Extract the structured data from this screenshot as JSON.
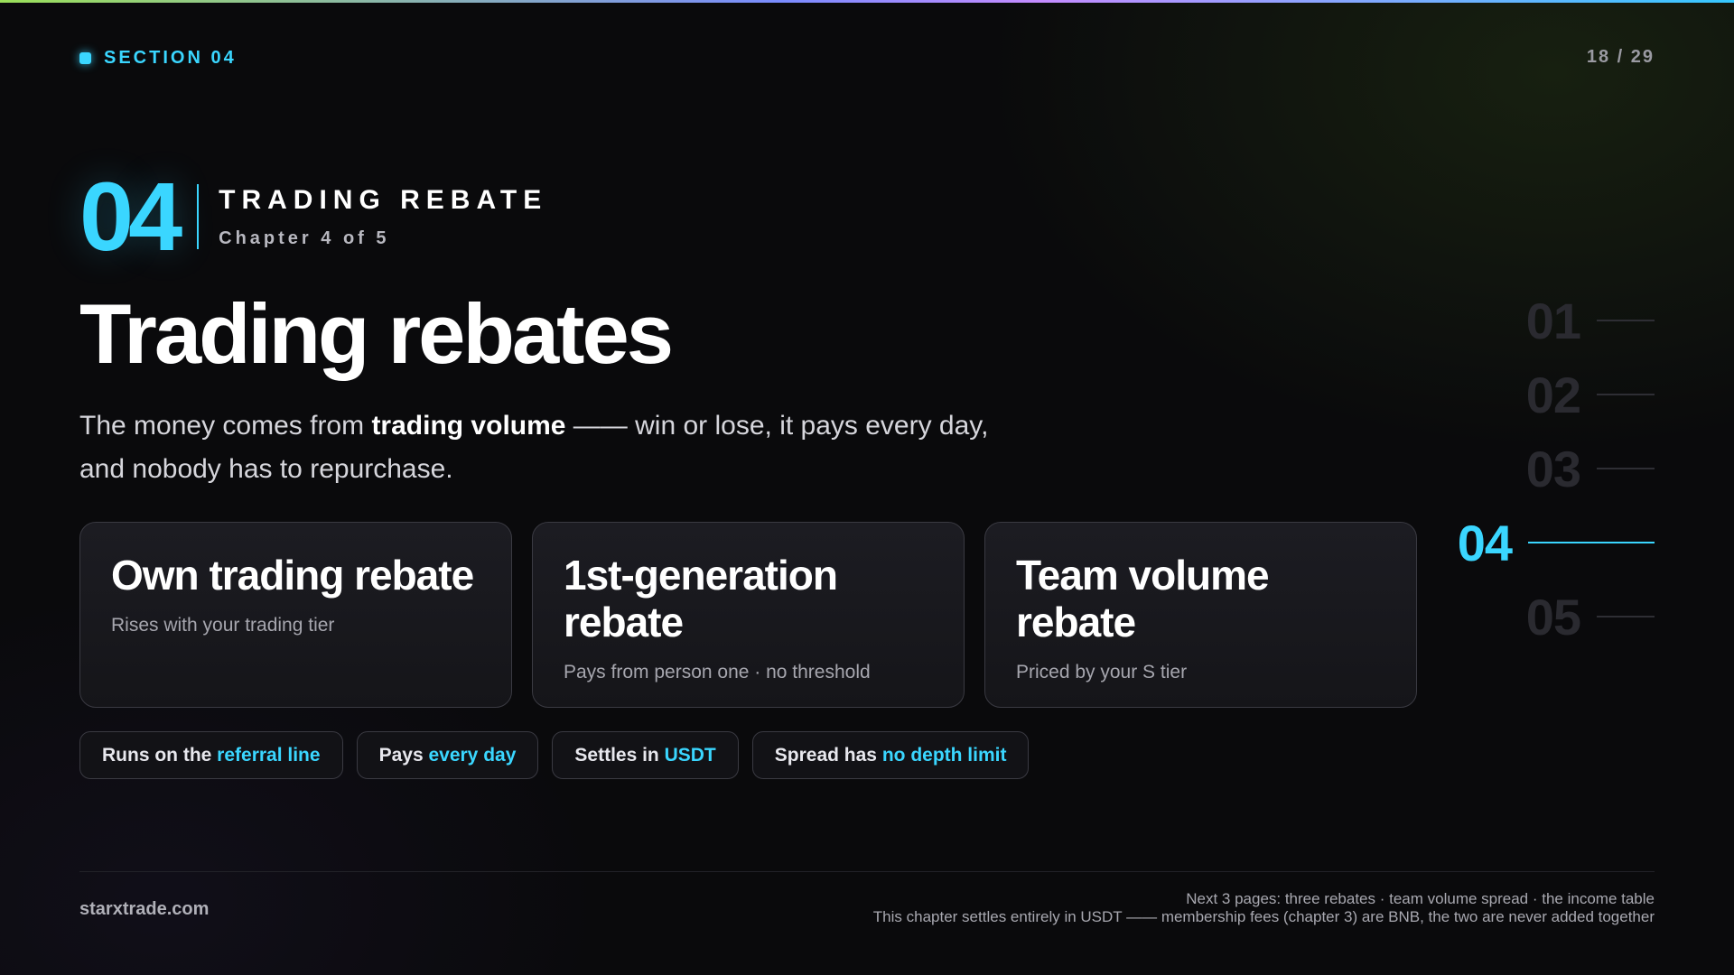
{
  "section": {
    "label": "SECTION 04",
    "page": "18 / 29"
  },
  "chapter": {
    "number": "04",
    "title": "TRADING REBATE",
    "subtitle": "Chapter 4 of 5"
  },
  "title": "Trading rebates",
  "lead": {
    "part1": "The money comes from ",
    "bold": "trading volume",
    "part2": " —— win or lose, it pays every day,",
    "line2": "and nobody has to repurchase."
  },
  "cards": [
    {
      "title": "Own trading rebate",
      "subtitle": "Rises with your trading tier"
    },
    {
      "title": "1st-generation rebate",
      "subtitle": "Pays from person one · no threshold"
    },
    {
      "title": "Team volume rebate",
      "subtitle": "Priced by your S tier"
    }
  ],
  "pills": [
    {
      "prefix": "Runs on the ",
      "highlight": "referral line"
    },
    {
      "prefix": "Pays ",
      "highlight": "every day"
    },
    {
      "prefix": "Settles in ",
      "highlight": "USDT"
    },
    {
      "prefix": "Spread has ",
      "highlight": "no depth limit"
    }
  ],
  "nav": {
    "items": [
      "01",
      "02",
      "03",
      "04",
      "05"
    ],
    "active": "04"
  },
  "footer": {
    "brand": "starxtrade.com",
    "note1": "Next 3 pages: three rebates · team volume spread · the income table",
    "note2": "This chapter settles entirely in USDT —— membership fees (chapter 3) are BNB, the two are never added together"
  },
  "colors": {
    "accent": "#3ad6ff",
    "background": "#0a0a0c",
    "card_border": "#3a3a42",
    "muted_nav": "#2a2a30"
  }
}
